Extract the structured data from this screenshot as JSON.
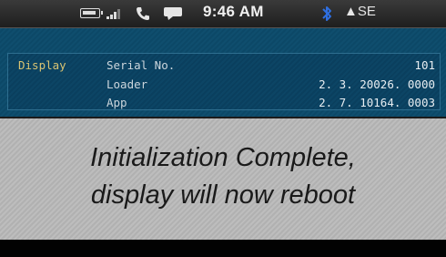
{
  "status_bar": {
    "time": "9:46 AM",
    "compass": "▲SE",
    "icons": [
      "battery-icon",
      "signal-icon",
      "phone-icon",
      "chat-icon",
      "bluetooth-icon"
    ]
  },
  "info_panel": {
    "section_label": "Display",
    "rows": [
      {
        "label": "Serial No.",
        "value": "101"
      },
      {
        "label": "Loader",
        "value": "2. 3. 20026. 0000"
      },
      {
        "label": "App",
        "value": "2. 7. 10164. 0003"
      }
    ]
  },
  "message": {
    "line1": "Initialization Complete,",
    "line2": "display will now reboot"
  },
  "colors": {
    "accent_label": "#d8c372",
    "panel_blue": "#0f4e6e",
    "bluetooth": "#2f6fe0"
  }
}
